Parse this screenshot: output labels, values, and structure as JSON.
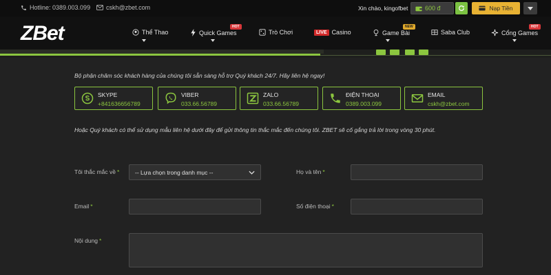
{
  "topbar": {
    "hotline": "Hotline: 0389.003.099",
    "email": "cskh@zbet.com",
    "greeting": "Xin chào, kingofbet",
    "balance": "600 đ",
    "deposit_label": "Nạp Tiền"
  },
  "nav": {
    "logo": "ZBet",
    "items": [
      {
        "label": "Thể Thao",
        "icon": "sports-ball-icon"
      },
      {
        "label": "Quick Games",
        "icon": "lightning-icon",
        "badge": "HOT"
      },
      {
        "label": "Trò Chơi",
        "icon": "dice-icon"
      },
      {
        "label": "Casino",
        "live": "LIVE"
      },
      {
        "label": "Game Bài",
        "icon": "cards-icon",
        "badge": "NEW"
      },
      {
        "label": "Saba Club",
        "icon": "building-icon"
      },
      {
        "label": "Cổng Games",
        "icon": "gamepad-icon",
        "badge": "HOT"
      }
    ]
  },
  "content": {
    "intro": "Bộ phận chăm sóc khách hàng của chúng tôi sẵn sàng hỗ trợ Quý khách 24/7. Hãy liên hệ ngay!",
    "channels": [
      {
        "title": "SKYPE",
        "value": "+841636656789",
        "icon": "skype-icon"
      },
      {
        "title": "VIBER",
        "value": "033.66.56789",
        "icon": "viber-icon"
      },
      {
        "title": "ZALO",
        "value": "033.66.56789",
        "icon": "zalo-icon"
      },
      {
        "title": "ĐIỆN THOẠI",
        "value": "0389.003.099",
        "icon": "phone-icon"
      },
      {
        "title": "EMAIL",
        "value": "cskh@zbet.com",
        "icon": "mail-icon"
      }
    ],
    "note": "Hoặc Quý khách có thể sử dụng mẫu liên hệ dưới đây để gửi thông tin thắc mắc đến chúng tôi. ZBET sẽ cố gắng trả lời trong vòng 30 phút."
  },
  "form": {
    "topic_label": "Tôi thắc mắc về",
    "topic_value": "-- Lựa chọn trong danh mục --",
    "name_label": "Họ và tên",
    "email_label": "Email",
    "phone_label": "Số điện thoại",
    "message_label": "Nội dung",
    "required_mark": "*"
  },
  "colors": {
    "accent": "#8cc63f",
    "gold": "#e8b233",
    "background": "#222222"
  }
}
